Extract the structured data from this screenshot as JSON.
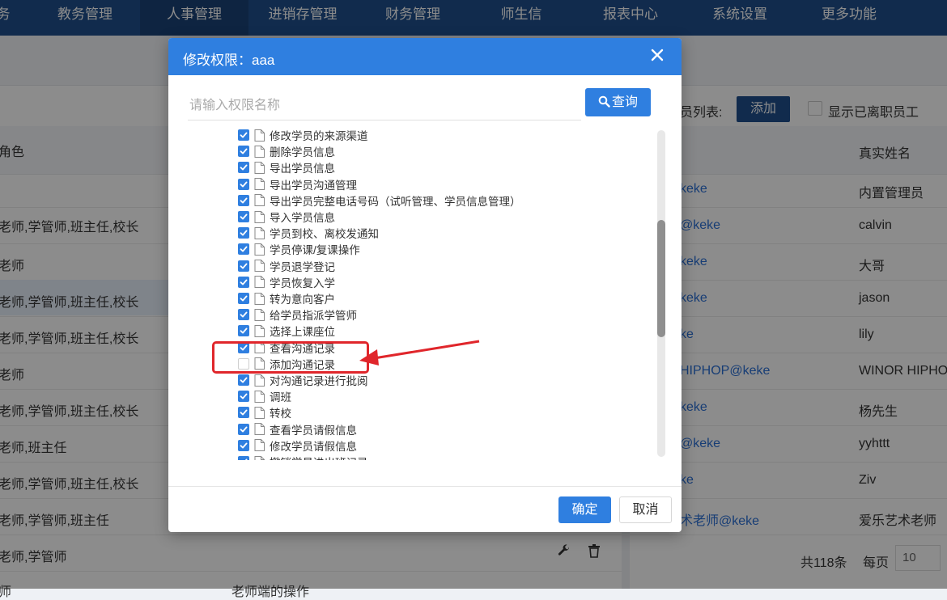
{
  "nav": {
    "items": [
      {
        "label": "务"
      },
      {
        "label": "教务管理"
      },
      {
        "label": "人事管理"
      },
      {
        "label": "进销存管理"
      },
      {
        "label": "财务管理"
      },
      {
        "label": "师生信"
      },
      {
        "label": "报表中心"
      },
      {
        "label": "系统设置"
      },
      {
        "label": "更多功能"
      }
    ],
    "active_index": 2
  },
  "background": {
    "left_header": "角色",
    "roles": [
      "老师,学管师,班主任,校长",
      "老师",
      "老师,学管师,班主任,校长",
      "老师,学管师,班主任,校长",
      "老师",
      "老师,学管师,班主任,校长",
      "老师,班主任",
      "老师,学管师,班主任,校长",
      "老师,学管师,班主任",
      "老师,学管师",
      "师"
    ],
    "bottom_partial_text": "老师端的操作",
    "right_toolbar": {
      "list_label": "员列表:",
      "add_label": "添加",
      "show_resigned_label": "显示已离职员工"
    },
    "right_header": "真实姓名",
    "accounts": [
      "keke",
      "@keke",
      "keke",
      "keke",
      "ke",
      "HIPHOP@keke",
      "keke",
      "@keke",
      "ke",
      "术老师@keke"
    ],
    "real_names": [
      "内置管理员",
      "calvin",
      "大哥",
      "jason",
      "lily",
      "WINOR HIPHOP",
      "杨先生",
      "yyhttt",
      "Ziv",
      "爱乐艺术老师"
    ],
    "pagination": {
      "total": "共118条",
      "per_page_label": "每页",
      "per_page_value": "10"
    }
  },
  "modal": {
    "title": "修改权限：aaa",
    "search_placeholder": "请输入权限名称",
    "search_button": "查询",
    "ok_label": "确定",
    "cancel_label": "取消",
    "permissions": [
      {
        "label": "修改学员的来源渠道",
        "checked": true
      },
      {
        "label": "删除学员信息",
        "checked": true
      },
      {
        "label": "导出学员信息",
        "checked": true
      },
      {
        "label": "导出学员沟通管理",
        "checked": true
      },
      {
        "label": "导出学员完整电话号码（试听管理、学员信息管理）",
        "checked": true
      },
      {
        "label": "导入学员信息",
        "checked": true
      },
      {
        "label": "学员到校、离校发通知",
        "checked": true
      },
      {
        "label": "学员停课/复课操作",
        "checked": true
      },
      {
        "label": "学员退学登记",
        "checked": true
      },
      {
        "label": "学员恢复入学",
        "checked": true
      },
      {
        "label": "转为意向客户",
        "checked": true
      },
      {
        "label": "给学员指派学管师",
        "checked": true
      },
      {
        "label": "选择上课座位",
        "checked": true
      },
      {
        "label": "查看沟通记录",
        "checked": true
      },
      {
        "label": "添加沟通记录",
        "checked": false
      },
      {
        "label": "对沟通记录进行批阅",
        "checked": true
      },
      {
        "label": "调班",
        "checked": true
      },
      {
        "label": "转校",
        "checked": true
      },
      {
        "label": "查看学员请假信息",
        "checked": true
      },
      {
        "label": "修改学员请假信息",
        "checked": true
      },
      {
        "label": "撤销学员进出班记录",
        "checked": true
      }
    ]
  },
  "colors": {
    "primary": "#2f7fe0",
    "nav_bg": "#1f4f8c",
    "annotation": "#e0262b"
  }
}
